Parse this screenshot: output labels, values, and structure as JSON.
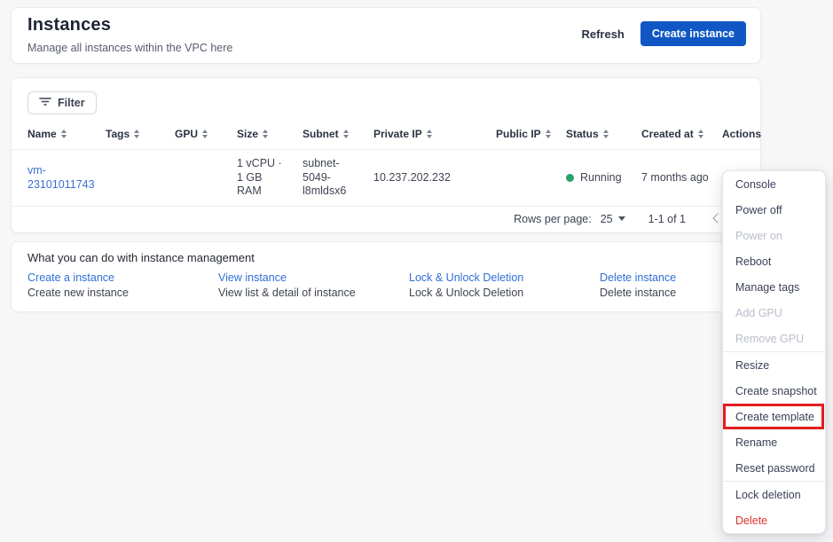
{
  "header": {
    "title": "Instances",
    "subtitle": "Manage all instances within the VPC here",
    "refresh_label": "Refresh",
    "create_label": "Create instance"
  },
  "table": {
    "filter_label": "Filter",
    "columns": [
      {
        "label": "Name",
        "sortable": true
      },
      {
        "label": "Tags",
        "sortable": true
      },
      {
        "label": "GPU",
        "sortable": true
      },
      {
        "label": "Size",
        "sortable": true
      },
      {
        "label": "Subnet",
        "sortable": true
      },
      {
        "label": "Private IP",
        "sortable": true
      },
      {
        "label": "Public IP",
        "sortable": true
      },
      {
        "label": "Status",
        "sortable": true
      },
      {
        "label": "Created at",
        "sortable": true
      },
      {
        "label": "Actions",
        "sortable": false
      }
    ],
    "row": {
      "name": "vm-23101011743",
      "tags": "",
      "gpu": "",
      "size": "1 vCPU · 1 GB RAM",
      "subnet": "subnet-5049-l8mldsx6",
      "private_ip": "10.237.202.232",
      "public_ip": "",
      "status": "Running",
      "created_at": "7 months ago"
    },
    "pagination": {
      "rows_per_page_label": "Rows per page:",
      "rows_per_page_value": "25",
      "range": "1-1 of 1"
    }
  },
  "help": {
    "title": "What you can do with instance management",
    "items": [
      {
        "link": "Create a instance",
        "desc": "Create new instance"
      },
      {
        "link": "View instance",
        "desc": "View list & detail of instance"
      },
      {
        "link": "Lock & Unlock Deletion",
        "desc": "Lock & Unlock Deletion"
      },
      {
        "link": "Delete instance",
        "desc": "Delete instance"
      }
    ]
  },
  "menu": {
    "items": [
      {
        "label": "Console",
        "state": "normal"
      },
      {
        "label": "Power off",
        "state": "normal"
      },
      {
        "label": "Power on",
        "state": "disabled"
      },
      {
        "label": "Reboot",
        "state": "normal"
      },
      {
        "label": "Manage tags",
        "state": "normal"
      },
      {
        "label": "Add GPU",
        "state": "disabled"
      },
      {
        "label": "Remove GPU",
        "state": "disabled"
      },
      {
        "label": "Resize",
        "state": "normal"
      },
      {
        "label": "Create snapshot",
        "state": "normal"
      },
      {
        "label": "Create template",
        "state": "normal",
        "highlighted": true
      },
      {
        "label": "Rename",
        "state": "normal"
      },
      {
        "label": "Reset password",
        "state": "normal"
      },
      {
        "label": "Lock deletion",
        "state": "normal"
      },
      {
        "label": "Delete",
        "state": "danger"
      }
    ]
  },
  "colors": {
    "primary_blue": "#1057c5",
    "link_blue": "#2f6fd8",
    "running_green": "#2aa06a",
    "danger_red": "#e0312e",
    "highlight_box_red": "#e01f1f"
  }
}
